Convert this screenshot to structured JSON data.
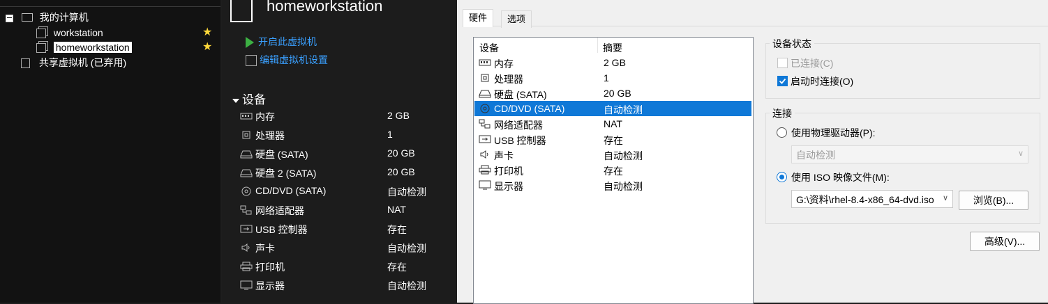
{
  "tree": {
    "root_label": "我的计算机",
    "vms": [
      {
        "label": "workstation",
        "starred": true
      },
      {
        "label": "homeworkstation",
        "starred": true
      }
    ],
    "shared_label": "共享虚拟机 (已弃用)"
  },
  "vm": {
    "title": "homeworkstation",
    "actions": [
      "开启此虚拟机",
      "编辑虚拟机设置"
    ],
    "devices_heading": "设备",
    "devices": [
      {
        "icon": "memory-icon",
        "name": "内存",
        "value": "2 GB"
      },
      {
        "icon": "processor-icon",
        "name": "处理器",
        "value": "1"
      },
      {
        "icon": "harddisk-icon",
        "name": "硬盘 (SATA)",
        "value": "20 GB"
      },
      {
        "icon": "harddisk-icon",
        "name": "硬盘 2 (SATA)",
        "value": "20 GB"
      },
      {
        "icon": "cd-dvd-icon",
        "name": "CD/DVD (SATA)",
        "value": "自动检测"
      },
      {
        "icon": "network-adapter-icon",
        "name": "网络适配器",
        "value": "NAT"
      },
      {
        "icon": "usb-icon",
        "name": "USB 控制器",
        "value": "存在"
      },
      {
        "icon": "sound-icon",
        "name": "声卡",
        "value": "自动检测"
      },
      {
        "icon": "printer-icon",
        "name": "打印机",
        "value": "存在"
      },
      {
        "icon": "display-icon",
        "name": "显示器",
        "value": "自动检测"
      }
    ]
  },
  "dialog": {
    "tabs": [
      "硬件",
      "选项"
    ],
    "list_headers": [
      "设备",
      "摘要"
    ],
    "list": [
      {
        "icon": "memory-icon",
        "name": "内存",
        "value": "2 GB"
      },
      {
        "icon": "processor-icon",
        "name": "处理器",
        "value": "1"
      },
      {
        "icon": "harddisk-icon",
        "name": "硬盘 (SATA)",
        "value": "20 GB"
      },
      {
        "icon": "cd-dvd-icon",
        "name": "CD/DVD (SATA)",
        "value": "自动检测",
        "selected": true
      },
      {
        "icon": "network-adapter-icon",
        "name": "网络适配器",
        "value": "NAT"
      },
      {
        "icon": "usb-icon",
        "name": "USB 控制器",
        "value": "存在"
      },
      {
        "icon": "sound-icon",
        "name": "声卡",
        "value": "自动检测"
      },
      {
        "icon": "printer-icon",
        "name": "打印机",
        "value": "存在"
      },
      {
        "icon": "display-icon",
        "name": "显示器",
        "value": "自动检测"
      }
    ],
    "device_status": {
      "title": "设备状态",
      "connected_label": "已连接(C)",
      "connected": false,
      "connect_on_start_label": "启动时连接(O)",
      "connect_on_start": true
    },
    "connection": {
      "title": "连接",
      "physical_label": "使用物理驱动器(P):",
      "physical_selected": false,
      "physical_value": "自动检测",
      "iso_label": "使用 ISO 映像文件(M):",
      "iso_selected": true,
      "iso_value": "G:\\资料\\rhel-8.4-x86_64-dvd.iso",
      "browse_label": "浏览(B)..."
    },
    "advanced_label": "高级(V)...",
    "colors": {
      "accent": "#0f78d7",
      "star": "#ffd83a",
      "link": "#3aa0ff"
    }
  }
}
